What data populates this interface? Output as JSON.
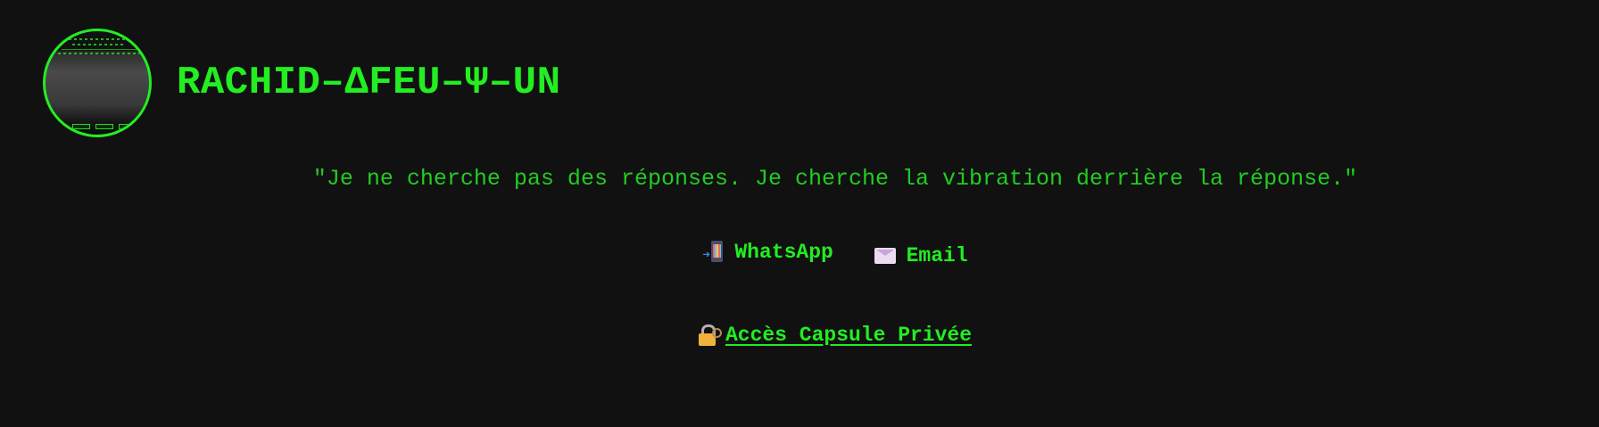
{
  "profile": {
    "title": "RACHID–ΔFEU–Ψ–UN",
    "avatar_alt": "terminal screen avatar"
  },
  "quote": "\"Je ne cherche pas des réponses. Je cherche la vibration derrière la réponse.\"",
  "contacts": [
    {
      "icon": "mobile-phone-arrow-icon",
      "label": "WhatsApp"
    },
    {
      "icon": "envelope-icon",
      "label": "Email"
    }
  ],
  "capsule": {
    "icon": "lock-with-key-icon",
    "label": "Accès Capsule Privée"
  },
  "colors": {
    "background": "#111111",
    "accent": "#22ee22"
  }
}
